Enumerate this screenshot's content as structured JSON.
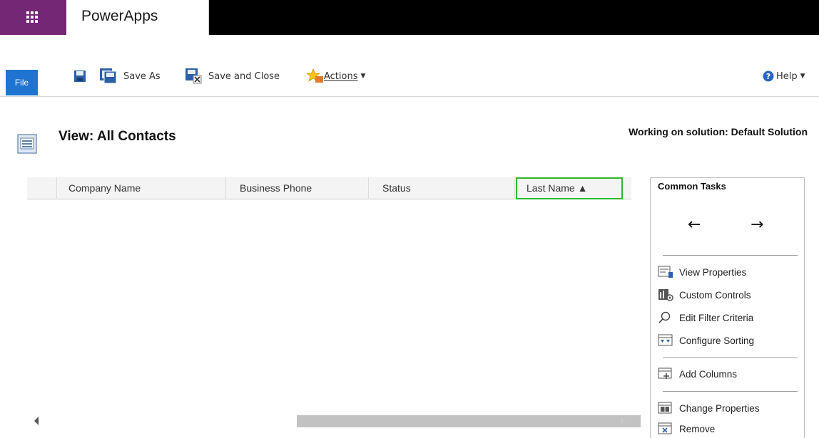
{
  "app": {
    "brand": "PowerApps"
  },
  "toolbar": {
    "file_label": "File",
    "save_label": "",
    "save_as_label": "Save As",
    "save_close_label": "Save and Close",
    "actions_label": "Actions",
    "help_label": "Help"
  },
  "page": {
    "title": "View: All Contacts",
    "solution": "Working on solution: Default Solution"
  },
  "grid": {
    "columns": [
      "Company Name",
      "Business Phone",
      "Status",
      "Last Name ▲"
    ]
  },
  "tasks": {
    "title": "Common Tasks",
    "back_arrow": "←",
    "forward_arrow": "→",
    "items": [
      "View Properties",
      "Custom Controls",
      "Edit Filter Criteria",
      "Configure Sorting",
      "Add Columns",
      "Change Properties",
      "Remove"
    ]
  },
  "colors": {
    "brand": "#742774",
    "file_button": "#1f73d1",
    "selected_column": "#2eb82e"
  }
}
